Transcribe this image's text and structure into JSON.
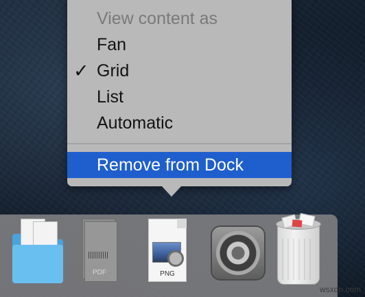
{
  "context_menu": {
    "header": "View content as",
    "items": [
      {
        "label": "Fan",
        "checked": false
      },
      {
        "label": "Grid",
        "checked": true
      },
      {
        "label": "List",
        "checked": false
      },
      {
        "label": "Automatic",
        "checked": false
      }
    ],
    "checkmark": "✓",
    "remove_label": "Remove from Dock",
    "highlight_color": "#1f5fcd"
  },
  "dock": {
    "items": [
      {
        "icon": "folder-icon"
      },
      {
        "icon": "pdf-document-icon",
        "label": "PDF"
      },
      {
        "icon": "png-document-icon",
        "label": "PNG"
      },
      {
        "icon": "system-preferences-icon"
      },
      {
        "icon": "trash-icon"
      }
    ]
  },
  "watermark": "wsxdn.com"
}
